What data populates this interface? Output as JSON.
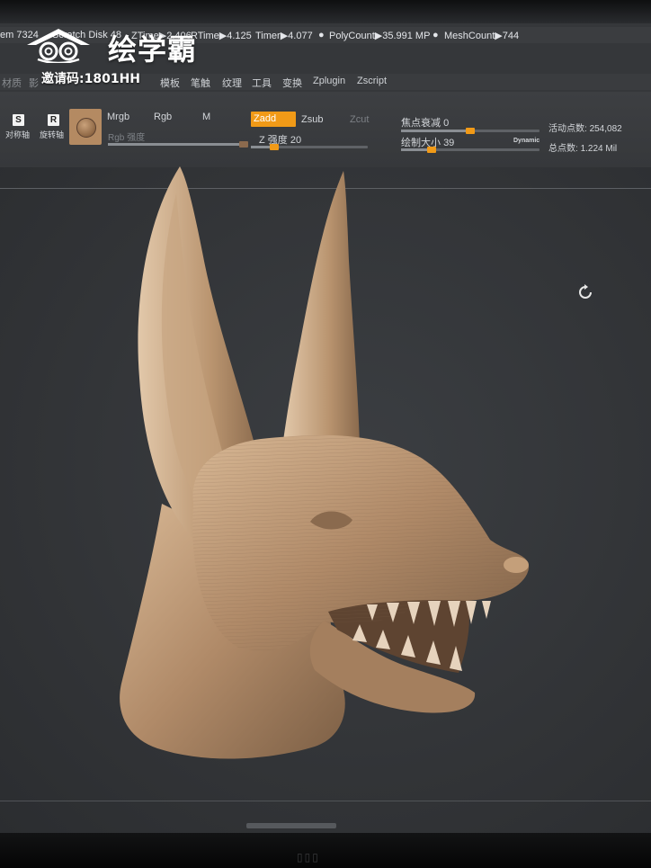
{
  "watermark": {
    "brand_text": "绘学霸",
    "invite_text": "邀请码:1801HH"
  },
  "status_bar": {
    "item_mem": "em 7324",
    "item_scratch": "Scratch Disk 48",
    "item_ztime": "ZTime▶2.406",
    "item_rtime": "RTime▶4.125",
    "item_timer": "Timer▶4.077",
    "item_polycount": "PolyCount▶35.991 MP",
    "item_meshcount": "MeshCount▶744"
  },
  "menu_bar": {
    "items": [
      "材质",
      "影",
      "模板",
      "笔触",
      "纹理",
      "工具",
      "变换",
      "Zplugin",
      "Zscript"
    ]
  },
  "tool_shelf": {
    "symmetry_key": "S",
    "symmetry_label": "对称轴",
    "rotate_key": "R",
    "rotate_label": "旋转轴",
    "mrgb_label": "Mrgb",
    "rgb_label": "Rgb",
    "m_label": "M",
    "rgb_intensity_label": "Rgb 强度",
    "zadd_label": "Zadd",
    "zsub_label": "Zsub",
    "zcut_label": "Zcut",
    "z_intensity_label": "Z 强度",
    "z_intensity_value": "20",
    "focal_shift_label": "焦点衰减",
    "focal_shift_value": "0",
    "draw_size_label": "绘制大小",
    "draw_size_value": "39",
    "dynamic_label": "Dynamic",
    "active_points_label": "活动点数:",
    "active_points_value": "254,082",
    "total_points_label": "总点数:",
    "total_points_value": "1.224 Mil",
    "z_intensity_level": 0.2,
    "focal_shift_level": 0.5,
    "draw_size_level": 0.22,
    "rgb_intensity_level": 1.0
  },
  "colors": {
    "accent": "#f19a17",
    "viewport_bg": "#35373a",
    "clay": "#b08a68"
  },
  "icons": {
    "viewport_refresh": "refresh-icon",
    "material_preview": "material-sphere-icon"
  }
}
